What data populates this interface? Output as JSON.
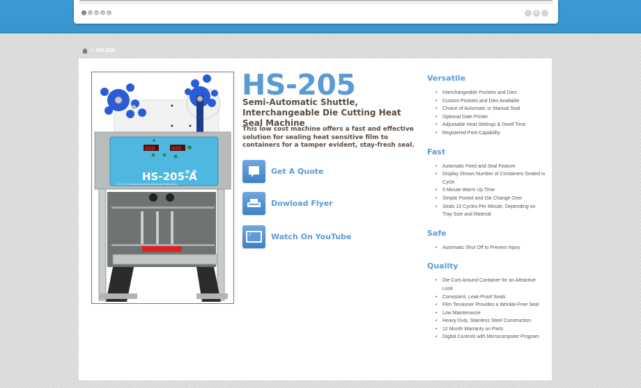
{
  "slider": {
    "dots": [
      {
        "label": "slide-1",
        "active": true
      },
      {
        "label": "slide-2",
        "active": false
      },
      {
        "label": "slide-3",
        "active": false
      },
      {
        "label": "slide-4",
        "active": false
      },
      {
        "label": "slide-5",
        "active": false
      }
    ],
    "controls": {
      "prev": "←",
      "pause": "II",
      "next": "→"
    }
  },
  "breadcrumb": {
    "separator": "»",
    "current": "HS-205"
  },
  "product": {
    "title": "HS-205",
    "subtitle": "Semi-Automatic Shuttle, Interchangeable Die Cutting Heat Seal Machine",
    "description": "This low cost machine offers a fast and effective solution for sealing heat sensitive film to containers for a tamper evident, stay-fresh seal.",
    "image": {
      "panel_label": "HS-205-A",
      "warning_text": "DO NOT PUT HANDS INSIDE MACHINE WHEN POWER IS ON",
      "display_left": "888",
      "display_right": "888"
    },
    "actions": [
      {
        "label": "Get A Quote",
        "icon": "speech-bubble-icon"
      },
      {
        "label": "Dowload Flyer",
        "icon": "printer-icon"
      },
      {
        "label": "Watch On YouTube",
        "icon": "tablet-icon"
      }
    ]
  },
  "features": [
    {
      "heading": "Versatile",
      "items": [
        "Interchangeable Pockets and Dies",
        "Custom Pockets and Dies Available",
        "Choice of Automatic or Manual Seal",
        "Optional Date Printer",
        "Adjustable Heat Settings & Dwell Time",
        "Registered Print Capability"
      ]
    },
    {
      "heading": "Fast",
      "items": [
        "Automatic Feed and Seal Feature",
        "Display Shows Number of Containers Sealed in Cycle",
        "5 Minute Warm Up Time",
        "Simple Pocket and Die Change Over",
        "Seals 10 Cycles Per Minute, Depending on Tray Size and Material"
      ]
    },
    {
      "heading": "Safe",
      "items": [
        "Automatic Shut Off to Prevent Injury"
      ]
    },
    {
      "heading": "Quality",
      "items": [
        "Die Cuts Around Container for an Attractive Look",
        "Consistent, Leak-Proof Seals",
        "Film Tensioner Provides a Wrinkle-Free Seal",
        "Low Maintenance",
        "Heavy Duty, Stainless Steel Construction",
        "12 Month Warranty on Parts",
        "Digital Controls with Microcomputer Program"
      ]
    }
  ],
  "colors": {
    "accent": "#5b9bd5",
    "header_band": "#3b9ad6",
    "body_text": "#5a4b40",
    "panel": "#4fb8e0"
  }
}
